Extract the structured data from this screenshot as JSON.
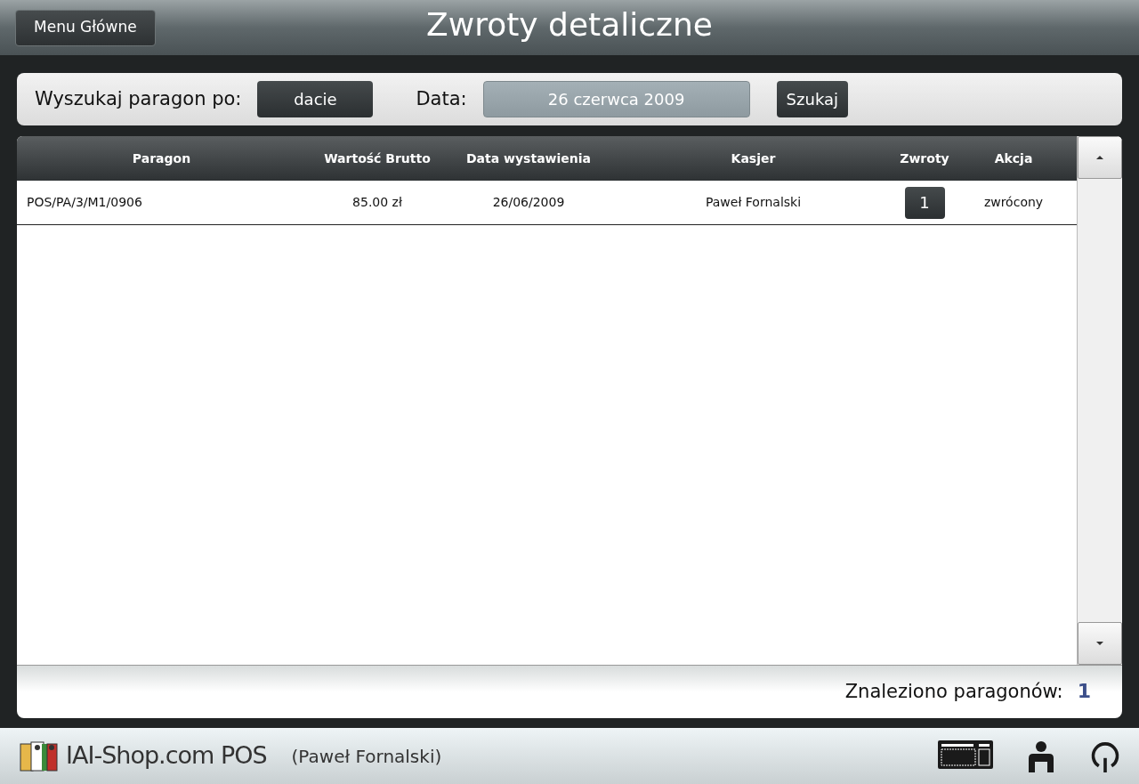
{
  "header": {
    "menu_button": "Menu Główne",
    "title": "Zwroty detaliczne"
  },
  "search": {
    "label": "Wyszukaj paragon po:",
    "mode_button": "dacie",
    "date_label": "Data:",
    "date_value": "26 czerwca 2009",
    "search_button": "Szukaj"
  },
  "table": {
    "columns": [
      "Paragon",
      "Wartość Brutto",
      "Data wystawienia",
      "Kasjer",
      "Zwroty",
      "Akcja"
    ],
    "rows": [
      {
        "receipt": "POS/PA/3/M1/0906",
        "gross_value": "85.00 zł",
        "issue_date": "26/06/2009",
        "cashier": "Paweł Fornalski",
        "returns": "1",
        "action": "zwrócony"
      }
    ]
  },
  "summary": {
    "label": "Znaleziono paragonów:",
    "count": "1"
  },
  "status_bar": {
    "app_name": "IAI-Shop.com POS",
    "user": "(Paweł Fornalski)"
  }
}
